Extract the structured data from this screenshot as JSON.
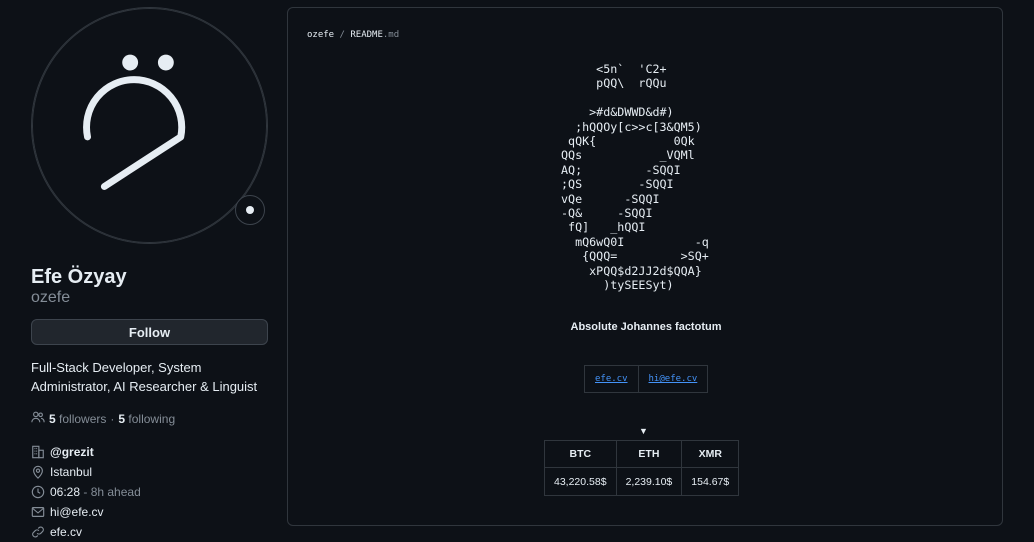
{
  "profile": {
    "name": "Efe Özyay",
    "login": "ozefe",
    "follow_label": "Follow",
    "bio": "Full-Stack Developer, System Administrator, AI Researcher & Linguist",
    "followers_count": "5",
    "followers_label": "followers",
    "following_count": "5",
    "following_label": "following",
    "organization": "@grezit",
    "location": "Istanbul",
    "local_time": "06:28",
    "time_offset": "- 8h ahead",
    "email": "hi@efe.cv",
    "website": "efe.cv"
  },
  "readme": {
    "owner": "ozefe",
    "separator": "/",
    "file_base": "README",
    "file_ext": ".md",
    "ascii_art": "     <5n`  'C2+\n     pQQ\\  rQQu\n\n    >#d&DWWD&d#)\n  ;hQQOy[c>>c[3&QM5)\n qQK{           0Qk\nQQs           _VQMl\nAQ;         -SQQI\n;QS        -SQQI\nvQe      -SQQI\n-Q&     -SQQI\n fQ]   _hQQI\n  mQ6wQ0I          -q\n   {QQQ=         >SQ+\n    xPQQ$d2JJ2d$QQA}\n      )tySEESyt)",
    "tagline": "Absolute Johannes factotum",
    "links": [
      "efe.cv",
      "hi@efe.cv"
    ],
    "arrow": "▼",
    "table": {
      "headers": [
        "BTC",
        "ETH",
        "XMR"
      ],
      "values": [
        "43,220.58$",
        "2,239.10$",
        "154.67$"
      ]
    }
  },
  "icons": {
    "people": "people-icon",
    "organization": "organization-icon",
    "location": "location-icon",
    "clock": "clock-icon",
    "mail": "mail-icon",
    "link": "link-icon"
  }
}
